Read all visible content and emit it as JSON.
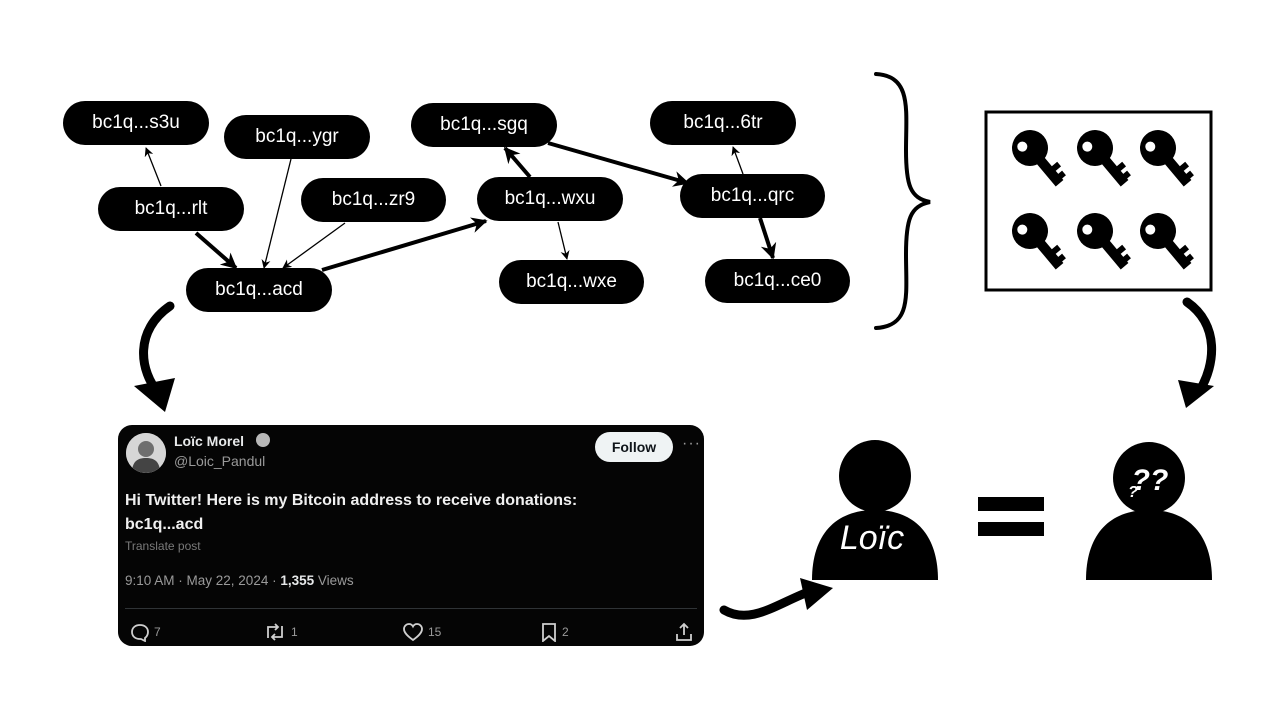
{
  "graph": {
    "nodes": [
      {
        "id": "s3u",
        "label": "bc1q...s3u"
      },
      {
        "id": "ygr",
        "label": "bc1q...ygr"
      },
      {
        "id": "rlt",
        "label": "bc1q...rlt"
      },
      {
        "id": "zr9",
        "label": "bc1q...zr9"
      },
      {
        "id": "acd",
        "label": "bc1q...acd"
      },
      {
        "id": "sgq",
        "label": "bc1q...sgq"
      },
      {
        "id": "wxu",
        "label": "bc1q...wxu"
      },
      {
        "id": "wxe",
        "label": "bc1q...wxe"
      },
      {
        "id": "6tr",
        "label": "bc1q...6tr"
      },
      {
        "id": "qrc",
        "label": "bc1q...qrc"
      },
      {
        "id": "ce0",
        "label": "bc1q...ce0"
      }
    ]
  },
  "tweet": {
    "name": "Loïc Morel",
    "handle": "@Loic_Pandul",
    "follow_label": "Follow",
    "more": "···",
    "text_line1": "Hi Twitter! Here is my Bitcoin address to receive donations:",
    "text_line2": "bc1q...acd",
    "translate": "Translate post",
    "time": "9:10 AM · May 22, 2024 · ",
    "views_count": "1,355",
    "views_label": " Views",
    "replies": "7",
    "reposts": "1",
    "likes": "15",
    "bookmarks": "2"
  },
  "person_label": "Loïc",
  "unknown_person_marks": "??",
  "icons": [
    "key-icon",
    "person-icon",
    "unknown-person-icon",
    "equals-icon",
    "curly-brace-icon",
    "curved-arrow-icon"
  ]
}
